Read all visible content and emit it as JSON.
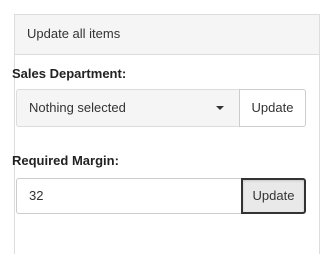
{
  "panel": {
    "heading": "Update all items"
  },
  "sales_department": {
    "label": "Sales Department:",
    "selected": "Nothing selected",
    "update_label": "Update"
  },
  "required_margin": {
    "label": "Required Margin:",
    "value": "32",
    "update_label": "Update"
  }
}
